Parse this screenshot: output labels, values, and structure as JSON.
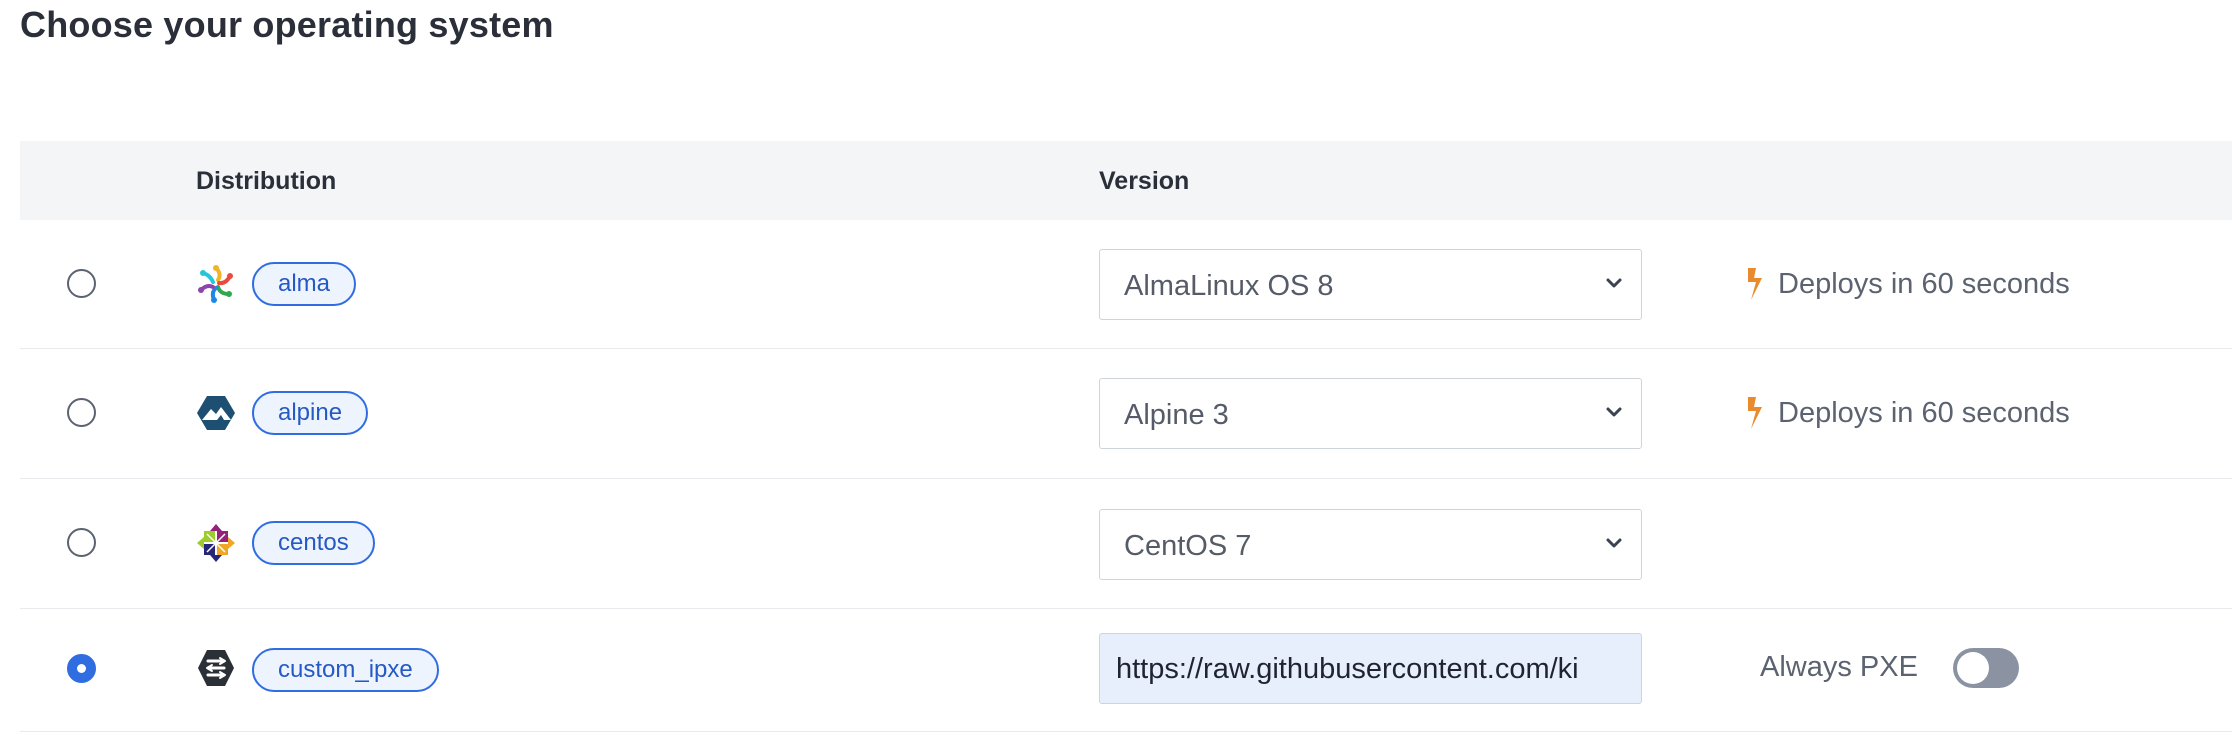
{
  "page": {
    "title": "Choose your operating system"
  },
  "table": {
    "headers": {
      "distribution": "Distribution",
      "version": "Version"
    },
    "rows": [
      {
        "distribution": "alma",
        "icon": "almalinux-logo-icon",
        "selected": false,
        "version": "AlmaLinux OS 8",
        "deploy_text": "Deploys in 60 seconds"
      },
      {
        "distribution": "alpine",
        "icon": "alpine-logo-icon",
        "selected": false,
        "version": "Alpine 3",
        "deploy_text": "Deploys in 60 seconds"
      },
      {
        "distribution": "centos",
        "icon": "centos-logo-icon",
        "selected": false,
        "version": "CentOS 7"
      },
      {
        "distribution": "custom_ipxe",
        "icon": "ipxe-logo-icon",
        "selected": true,
        "ipxe_url": "https://raw.githubusercontent.com/ki",
        "always_pxe_label": "Always PXE",
        "always_pxe_enabled": false
      }
    ]
  },
  "colors": {
    "accent": "#2f6de1",
    "bolt": "#e98a2c",
    "header_bg": "#f4f5f7",
    "toggle_off": "#8b93a3"
  }
}
